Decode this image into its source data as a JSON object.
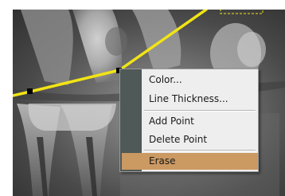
{
  "context_menu": {
    "items": [
      {
        "label": "Color..."
      },
      {
        "label": "Line Thickness..."
      },
      {
        "label": "Add Point"
      },
      {
        "label": "Delete Point"
      },
      {
        "label": "Erase",
        "highlighted": true
      }
    ]
  },
  "colors": {
    "measurement_line": "#f2e415",
    "control_point": "#000000",
    "menu_gutter": "#4f5957",
    "menu_background": "#eeeeee",
    "menu_highlight": "#cb9962",
    "selection_box": "#f2e415"
  }
}
